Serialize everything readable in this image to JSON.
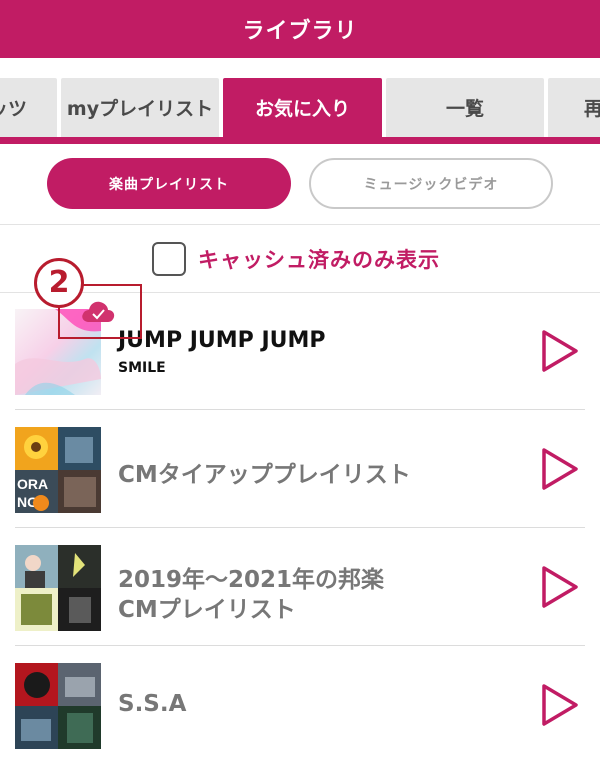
{
  "header": {
    "title": "ライブラリ"
  },
  "tabs": [
    {
      "label": "ッツ",
      "active": false
    },
    {
      "label": "myプレイリスト",
      "active": false
    },
    {
      "label": "お気に入り",
      "active": true
    },
    {
      "label": "一覧",
      "active": false
    },
    {
      "label": "再",
      "active": false
    }
  ],
  "segments": {
    "left": "楽曲プレイリスト",
    "right": "ミュージックビデオ"
  },
  "cache_filter": {
    "label": "キャッシュ済みのみ表示",
    "checked": false
  },
  "annotation": {
    "number": "2"
  },
  "items": [
    {
      "title": "JUMP JUMP JUMP",
      "subtitle": "SMILE",
      "cached": true
    },
    {
      "title": "CMタイアッププレイリスト"
    },
    {
      "title_line1": "2019年〜2021年の邦楽",
      "title_line2": "CMプレイリスト"
    },
    {
      "title": "S.S.A"
    }
  ],
  "colors": {
    "accent": "#c11c64",
    "annotation": "#b81c2e",
    "tab_inactive": "#e6e6e6"
  }
}
